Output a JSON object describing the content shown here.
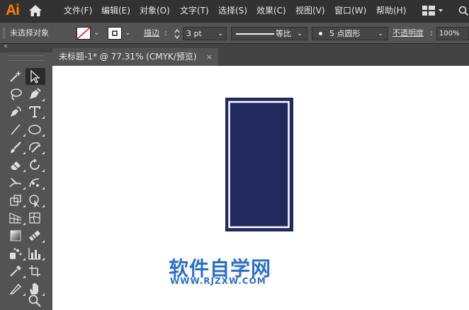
{
  "app": {
    "logo": "Ai"
  },
  "menubar": {
    "items": [
      "文件(F)",
      "编辑(E)",
      "对象(O)",
      "文字(T)",
      "选择(S)",
      "效果(C)",
      "视图(V)",
      "窗口(W)",
      "帮助(H)"
    ]
  },
  "control_bar": {
    "selection_status": "未选择对象",
    "stroke_label": "描边",
    "stroke_value": "3 pt",
    "profile_label": "等比",
    "brush_label": "5 点圆形",
    "opacity_label": "不透明度",
    "opacity_value": "100%"
  },
  "document_tab": {
    "title": "未标题-1* @ 77.31% (CMYK/预览)",
    "close": "×"
  },
  "tools": [
    "magic-wand-tool",
    "direct-selection-tool",
    "lasso-tool",
    "pen-tool",
    "curvature-tool",
    "type-tool",
    "line-tool",
    "ellipse-tool",
    "paintbrush-tool",
    "blob-brush-tool",
    "eraser-tool",
    "rotate-tool",
    "warp-tool",
    "puppet-warp-tool",
    "free-transform-tool",
    "shape-builder-tool",
    "perspective-grid-tool",
    "mesh-tool",
    "gradient-tool",
    "blend-tool",
    "symbol-sprayer-tool",
    "column-graph-tool",
    "eyedropper-tool",
    "artboard-tool",
    "slice-tool",
    "hand-tool",
    "zoom-tool"
  ],
  "canvas": {
    "artwork_fill": "#22295e",
    "artwork_inner_stroke": "#ffffff"
  },
  "watermark": {
    "title": "软件自学网",
    "url": "WWW.RJZXW.COM",
    "color": "#2a6fd0"
  },
  "colors": {
    "menubar_bg": "#323232",
    "panel_bg": "#535353",
    "logo": "#FF7C00"
  }
}
